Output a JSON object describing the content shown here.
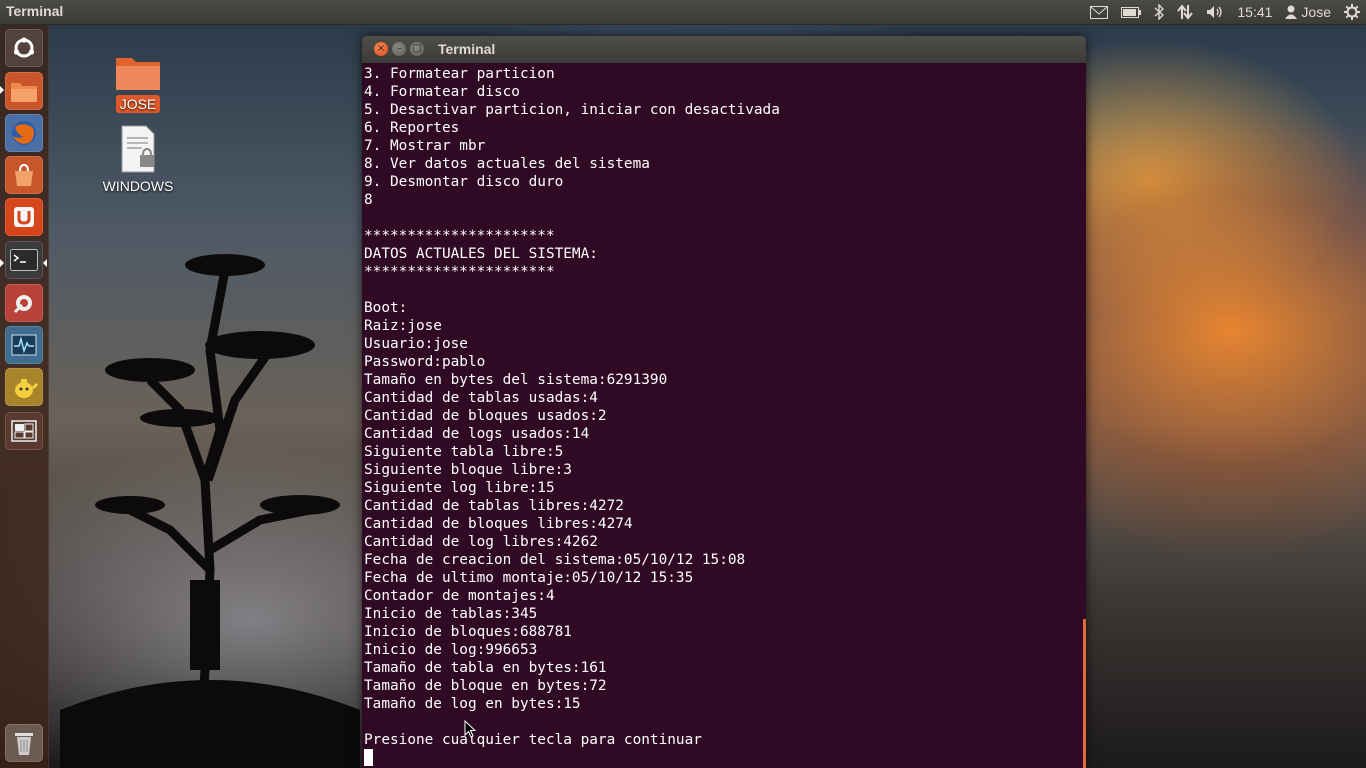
{
  "top_panel": {
    "app_title": "Terminal",
    "clock": "15:41",
    "user_name": "Jose",
    "indicators": [
      "mail-icon",
      "battery-icon",
      "bluetooth-icon",
      "network-icon",
      "volume-icon",
      "user-icon",
      "settings-gear-icon"
    ]
  },
  "launcher": {
    "items": [
      "dash-home-icon",
      "files-icon",
      "firefox-icon",
      "software-center-icon",
      "ubuntu-one-icon",
      "terminal-icon",
      "system-settings-icon",
      "system-monitor-icon",
      "teapot-app-icon",
      "workspace-switcher-icon",
      "trash-icon"
    ]
  },
  "desktop": {
    "icons": [
      {
        "label": "JOSE",
        "icon": "folder-icon"
      },
      {
        "label": "WINDOWS",
        "icon": "locked-document-icon"
      }
    ]
  },
  "window": {
    "title": "Terminal",
    "close_glyph": "×",
    "min_glyph": "–",
    "max_glyph": "□"
  },
  "terminal": {
    "lines": [
      "3. Formatear particion",
      "4. Formatear disco",
      "5. Desactivar particion, iniciar con desactivada",
      "6. Reportes",
      "7. Mostrar mbr",
      "8. Ver datos actuales del sistema",
      "9. Desmontar disco duro",
      "8",
      "",
      "**********************",
      "DATOS ACTUALES DEL SISTEMA:",
      "**********************",
      "",
      "Boot:",
      "Raiz:jose",
      "Usuario:jose",
      "Password:pablo",
      "Tamaño en bytes del sistema:6291390",
      "Cantidad de tablas usadas:4",
      "Cantidad de bloques usados:2",
      "Cantidad de logs usados:14",
      "Siguiente tabla libre:5",
      "Siguiente bloque libre:3",
      "Siguiente log libre:15",
      "Cantidad de tablas libres:4272",
      "Cantidad de bloques libres:4274",
      "Cantidad de log libres:4262",
      "Fecha de creacion del sistema:05/10/12 15:08",
      "Fecha de ultimo montaje:05/10/12 15:35",
      "Contador de montajes:4",
      "Inicio de tablas:345",
      "Inicio de bloques:688781",
      "Inicio de log:996653",
      "Tamaño de tabla en bytes:161",
      "Tamaño de bloque en bytes:72",
      "Tamaño de log en bytes:15",
      "",
      "Presione cualquier tecla para continuar"
    ]
  },
  "colors": {
    "terminal_bg": "#300a24",
    "terminal_fg": "#ffffff",
    "accent": "#e0592a",
    "panel_bg": "#3c3b37"
  }
}
